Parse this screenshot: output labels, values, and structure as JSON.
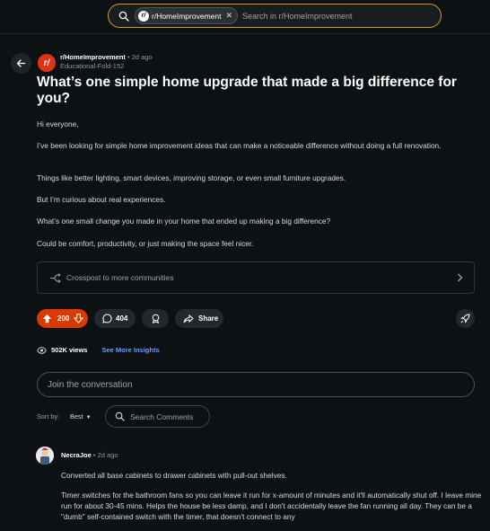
{
  "header": {
    "search_chip": "r/HomeImprovement",
    "search_chip_logo": "r/",
    "search_placeholder": "Search in r/HomeImprovement",
    "accent_color": "#d59a1e"
  },
  "post": {
    "subreddit_logo": "r/",
    "subreddit": "r/HomeImprovement",
    "separator": "•",
    "age": "2d ago",
    "author": "Educational-Fold-152",
    "title": "What’s one simple home upgrade that made a big difference for you?",
    "paragraphs": [
      "Hi everyone,",
      "I’ve been looking for simple home improvement ideas that can make a noticeable difference without doing a full renovation.",
      "Things like better lighting, smart devices, improving storage, or even small furniture upgrades.",
      "But I’m curious about real experiences.",
      "What’s one small change you made in your home that ended up making a big difference?",
      "Could be comfort, productivity, or just making the space feel nicer."
    ],
    "crosspost_label": "Crosspost to more communities",
    "votes": "200",
    "comments": "404",
    "share_label": "Share",
    "vote_color": "#d93a00",
    "views": "502K views",
    "insights_link": "See More Insights"
  },
  "conversation": {
    "join_placeholder": "Join the conversation",
    "sort_by_label": "Sort by:",
    "sort_value": "Best",
    "search_comments_placeholder": "Search Comments"
  },
  "comment": {
    "author": "NecraJoe",
    "separator": "•",
    "age": "2d ago",
    "paragraphs": [
      "Converted all base cabinets to drawer cabinets with pull-out shelves.",
      "Timer switches for the bathroom fans so you can leave it run for x-amount of minutes and it'll automatically shut off. I leave mine run for about 30-45 mins. Helps the house be less damp, and I don't accidentally leave the fan running all day. They can be a \"dumb\" self-contained switch with the timer, that doesn't connect to any"
    ]
  },
  "icons": [
    "search-icon",
    "close-icon",
    "back-arrow-icon",
    "crosspost-icon",
    "chevron-right-icon",
    "upvote-icon",
    "downvote-icon",
    "comment-icon",
    "award-icon",
    "share-icon",
    "boost-icon",
    "eye-icon"
  ]
}
